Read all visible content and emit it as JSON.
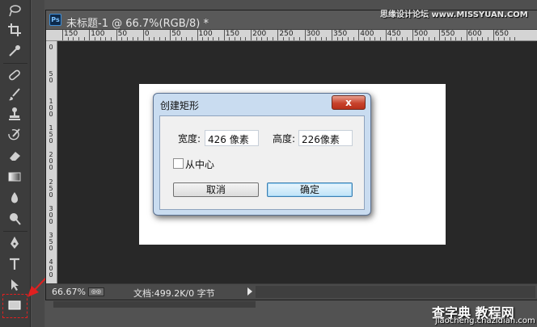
{
  "document": {
    "title": "未标题-1 @ 66.7%(RGB/8) *",
    "app_badge": "Ps"
  },
  "ruler": {
    "top_labels": [
      "150",
      "100",
      "50",
      "0",
      "50",
      "100",
      "150",
      "200",
      "250",
      "300",
      "350",
      "400",
      "450",
      "500",
      "550",
      "600",
      "650"
    ],
    "left_labels": [
      "0",
      "5 0",
      "1 0 0",
      "1 5 0",
      "2 0 0",
      "2 5 0",
      "3 0 0",
      "3 5 0",
      "4 0 0"
    ]
  },
  "status": {
    "zoom": "66.67%",
    "doc_info": "文档:499.2K/0 字节",
    "zoom_button": "◎◎"
  },
  "dialog": {
    "title": "创建矩形",
    "close_label": "x",
    "width_label": "宽度:",
    "width_value": "426 像素",
    "height_label": "高度:",
    "height_value": "226像素",
    "from_center_label": "从中心",
    "from_center_checked": false,
    "cancel_label": "取消",
    "ok_label": "确定"
  },
  "watermark": {
    "top": "思缘设计论坛  www.MISSYUAN.COM",
    "bottom_big": "查字典 教程网",
    "bottom_small": "jiaocheng.chazidian.com"
  },
  "colors": {
    "annotation_red": "#e02020",
    "dialog_frame": "#c9dcf0",
    "close_red": "#c8432c"
  },
  "tools": [
    "lasso-icon",
    "crop-icon",
    "eyedropper-icon",
    "healing-brush-icon",
    "brush-icon",
    "clone-stamp-icon",
    "history-brush-icon",
    "eraser-icon",
    "gradient-icon",
    "blur-icon",
    "dodge-icon",
    "pen-icon",
    "type-icon",
    "path-selection-icon",
    "rectangle-icon"
  ]
}
